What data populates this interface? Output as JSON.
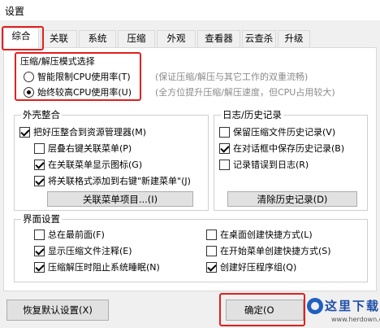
{
  "window": {
    "title": "设置"
  },
  "tabs": [
    "综合",
    "关联",
    "系统",
    "压缩",
    "外观",
    "查看器",
    "云查杀",
    "升级"
  ],
  "mode": {
    "title": "压缩/解压模式选择",
    "options": [
      {
        "label": "智能限制CPU使用率(T)",
        "hint": "(保证压缩/解压与其它工作的双重流畅)",
        "checked": false
      },
      {
        "label": "始终较高CPU使用率(U)",
        "hint": "(全方位提升压缩/解压速度，但CPU占用较大)",
        "checked": true
      }
    ]
  },
  "shell": {
    "title": "外壳整合",
    "items": [
      {
        "label": "把好压整合到资源管理器(M)",
        "checked": true
      },
      {
        "label": "层叠右键关联菜单(P)",
        "checked": false
      },
      {
        "label": "在关联菜单显示图标(G)",
        "checked": true
      },
      {
        "label": "将关联格式添加到右键\"新建菜单\"(J)",
        "checked": true
      }
    ],
    "button": "关联菜单项目...(I)"
  },
  "log": {
    "title": "日志/历史记录",
    "items": [
      {
        "label": "保留压缩文件历史记录(V)",
        "checked": false
      },
      {
        "label": "在对话框中保存历史记录(B)",
        "checked": true
      },
      {
        "label": "记录错误到日志(R)",
        "checked": false
      }
    ],
    "button": "清除历史记录(D)"
  },
  "ui": {
    "title": "界面设置",
    "items": [
      {
        "label": "总在最前面(F)",
        "checked": false
      },
      {
        "label": "在桌面创建快捷方式(L)",
        "checked": false
      },
      {
        "label": "显示压缩文件注释(E)",
        "checked": true
      },
      {
        "label": "在开始菜单创建快捷方式(S)",
        "checked": false
      },
      {
        "label": "压缩解压时阻止系统睡眠(N)",
        "checked": true
      },
      {
        "label": "创建好压程序组(Q)",
        "checked": true
      }
    ]
  },
  "footer": {
    "restore": "恢复默认设置(X)",
    "ok": "确定(O"
  },
  "watermark": {
    "text": "这里下载",
    "url": "www.herdown.com"
  },
  "colors": {
    "highlight": "#e02020"
  }
}
